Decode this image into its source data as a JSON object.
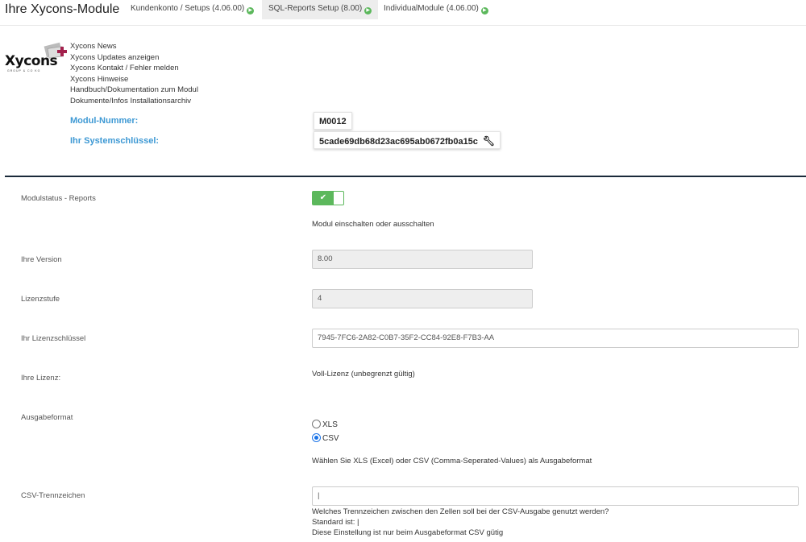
{
  "header": {
    "title": "Ihre Xycons-Module",
    "tabs": [
      {
        "label": "Kundenkonto / Setups (4.06.00)",
        "active": false
      },
      {
        "label": "SQL-Reports Setup (8.00)",
        "active": true
      },
      {
        "label": "IndividualModule (4.06.00)",
        "active": false
      }
    ]
  },
  "logo": {
    "text": "Xycons",
    "sub": "GROUP & CO KG"
  },
  "links": [
    "Xycons News",
    "Xycons Updates anzeigen",
    "Xycons Kontakt / Fehler melden",
    "Xycons Hinweise",
    "Handbuch/Dokumentation zum Modul",
    "Dokumente/Infos Installationsarchiv"
  ],
  "keys": {
    "module_number_label": "Modul-Nummer:",
    "module_number": "M0012",
    "system_key_label": "Ihr Systemschlüssel:",
    "system_key": "5cade69db68d23ac695ab0672fb0a15c"
  },
  "settings": {
    "status": {
      "label": "Modulstatus - Reports",
      "enabled": true,
      "hint": "Modul einschalten oder ausschalten"
    },
    "version": {
      "label": "Ihre Version",
      "value": "8.00"
    },
    "license_level": {
      "label": "Lizenzstufe",
      "value": "4"
    },
    "license_key": {
      "label": "Ihr Lizenzschlüssel",
      "value": "7945-7FC6-2A82-C0B7-35F2-CC84-92E8-F7B3-AA"
    },
    "license": {
      "label": "Ihre Lizenz:",
      "value": "Voll-Lizenz (unbegrenzt gültig)"
    },
    "output_format": {
      "label": "Ausgabeformat",
      "options": [
        "XLS",
        "CSV"
      ],
      "selected": "CSV",
      "hint": "Wählen Sie XLS (Excel) oder CSV (Comma-Seperated-Values) als Ausgabeformat"
    },
    "csv_separator": {
      "label": "CSV-Trennzeichen",
      "value": "|",
      "hint1": "Welches Trennzeichen zwischen den Zellen soll bei der CSV-Ausgabe genutzt werden?",
      "hint2": "Standard ist: |",
      "hint3": "Diese Einstellung ist nur beim Ausgabeformat CSV gütig"
    }
  },
  "colors": {
    "accent_blue": "#3e99d4",
    "toggle_green": "#5cb85c",
    "divider": "#1a2a3a"
  }
}
